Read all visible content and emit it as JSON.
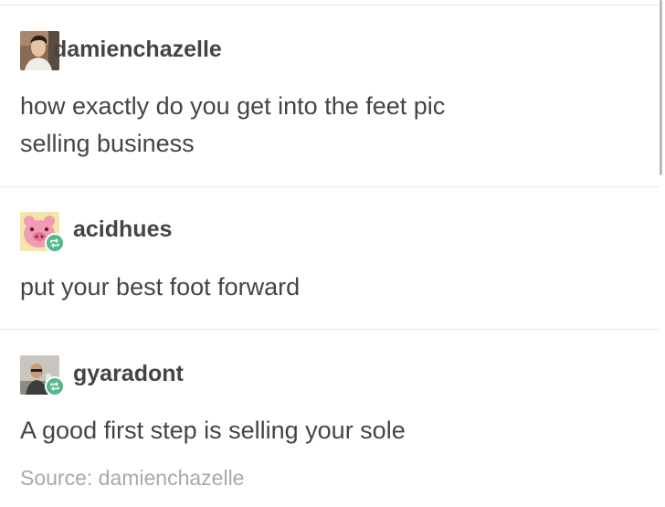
{
  "posts": [
    {
      "username": "damienchazelle",
      "avatar_icon": "man-portrait-avatar",
      "reblogged": false,
      "lines": [
        "how exactly do you get into the feet pic",
        "selling business"
      ]
    },
    {
      "username": "acidhues",
      "avatar_icon": "pink-pig-avatar",
      "reblogged": true,
      "lines": [
        "put your best foot forward"
      ]
    },
    {
      "username": "gyaradont",
      "avatar_icon": "person-photo-avatar",
      "reblogged": true,
      "lines": [
        "A good first step is selling your sole"
      ]
    }
  ],
  "source_label": "Source: damienchazelle",
  "colors": {
    "reblog_badge": "#55b88b",
    "divider": "#e8e8e8",
    "source_text": "#a9a9a9"
  }
}
